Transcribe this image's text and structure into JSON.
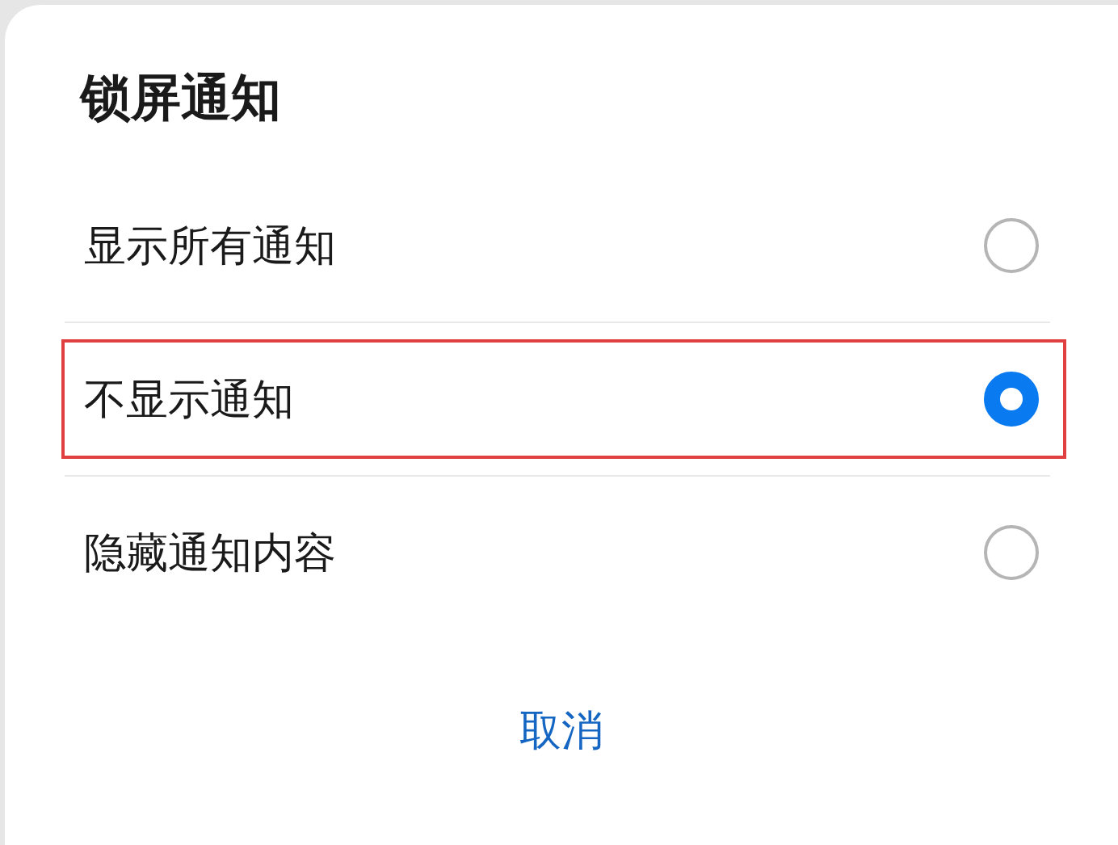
{
  "dialog": {
    "title": "锁屏通知",
    "options": [
      {
        "label": "显示所有通知",
        "selected": false,
        "highlighted": false
      },
      {
        "label": "不显示通知",
        "selected": true,
        "highlighted": true
      },
      {
        "label": "隐藏通知内容",
        "selected": false,
        "highlighted": false
      }
    ],
    "buttons": [
      "取消"
    ]
  }
}
